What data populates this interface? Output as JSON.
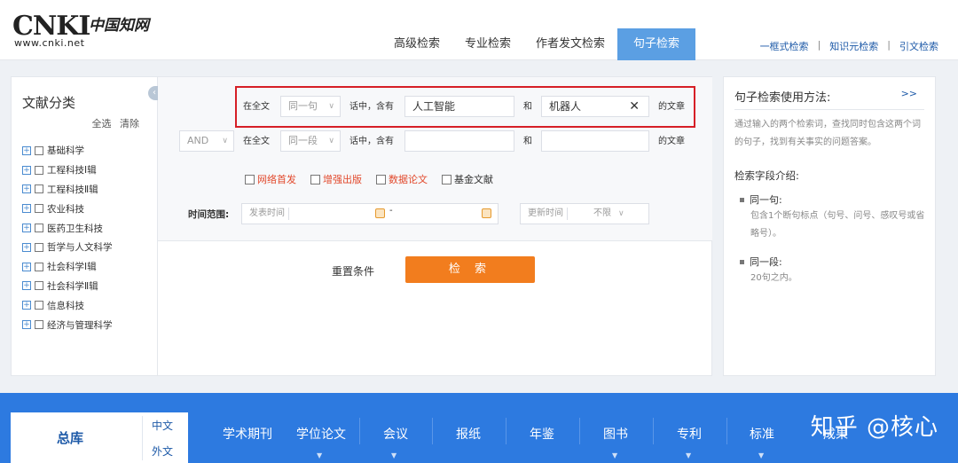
{
  "header": {
    "logo_text": "CNKI",
    "logo_cn": "中国知网",
    "logo_url": "www.cnki.net",
    "tabs": [
      "高级检索",
      "专业检索",
      "作者发文检索",
      "句子检索"
    ],
    "active_tab": "句子检索",
    "links": [
      "一框式检索",
      "知识元检索",
      "引文检索"
    ]
  },
  "left": {
    "title": "文献分类",
    "select_all": "全选",
    "clear": "清除",
    "categories": [
      "基础科学",
      "工程科技Ⅰ辑",
      "工程科技Ⅱ辑",
      "农业科技",
      "医药卫生科技",
      "哲学与人文科学",
      "社会科学Ⅰ辑",
      "社会科学Ⅱ辑",
      "信息科技",
      "经济与管理科学"
    ]
  },
  "search": {
    "row1": {
      "prefix": "在全文",
      "scope": "同一句",
      "mid": "话中，含有",
      "term1": "人工智能",
      "and": "和",
      "term2": "机器人",
      "suffix": "的文章"
    },
    "row2": {
      "logic": "AND",
      "prefix": "在全文",
      "scope": "同一段",
      "mid": "话中，含有",
      "term1": "",
      "and": "和",
      "term2": "",
      "suffix": "的文章"
    },
    "checkboxes": [
      "网络首发",
      "增强出版",
      "数据论文",
      "基金文献"
    ],
    "time_label": "时间范围:",
    "time_from_placeholder": "发表时间",
    "time_dash": "-",
    "update_label": "更新时间",
    "update_value": "不限",
    "reset": "重置条件",
    "search_btn": "检 索"
  },
  "help": {
    "title": "句子检索使用方法:",
    "more": ">>",
    "desc": "通过输入的两个检索词，查找同时包含这两个词的句子，找到有关事实的问题答案。",
    "fields_title": "检索字段介绍:",
    "f1_title": "同一句:",
    "f1_desc": "包含1个断句标点（句号、问号、感叹号或省略号）。",
    "f2_title": "同一段:",
    "f2_desc": "20句之内。"
  },
  "bottom": {
    "main": "总库",
    "zh": "中文",
    "wai": "外文",
    "dbs": [
      "学术期刊",
      "学位论文",
      "会议",
      "报纸",
      "年鉴",
      "图书",
      "专利",
      "标准",
      "成果"
    ],
    "watermark": "知乎 @核心"
  }
}
